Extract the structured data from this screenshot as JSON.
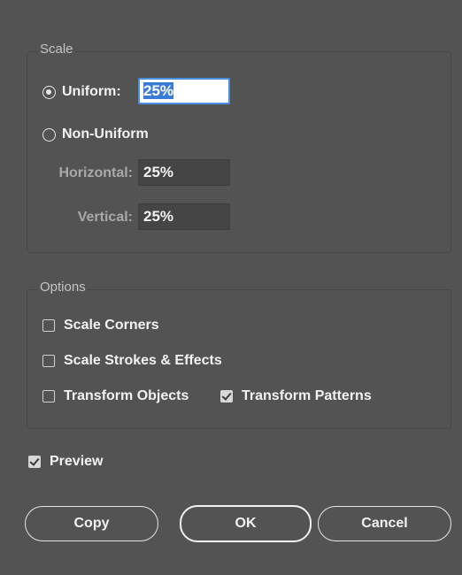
{
  "scale": {
    "title": "Scale",
    "uniform_label": "Uniform:",
    "uniform_value": "25%",
    "non_uniform_label": "Non-Uniform",
    "horizontal_label": "Horizontal:",
    "horizontal_value": "25%",
    "vertical_label": "Vertical:",
    "vertical_value": "25%",
    "selected": "uniform"
  },
  "options": {
    "title": "Options",
    "scale_corners": {
      "label": "Scale Corners",
      "checked": false
    },
    "scale_strokes": {
      "label": "Scale Strokes & Effects",
      "checked": false
    },
    "transform_objects": {
      "label": "Transform Objects",
      "checked": false
    },
    "transform_patterns": {
      "label": "Transform Patterns",
      "checked": true
    }
  },
  "preview": {
    "label": "Preview",
    "checked": true
  },
  "buttons": {
    "copy": "Copy",
    "ok": "OK",
    "cancel": "Cancel"
  },
  "colors": {
    "background": "#535353",
    "field_bg": "#454545",
    "selection": "#3a7bd5"
  }
}
